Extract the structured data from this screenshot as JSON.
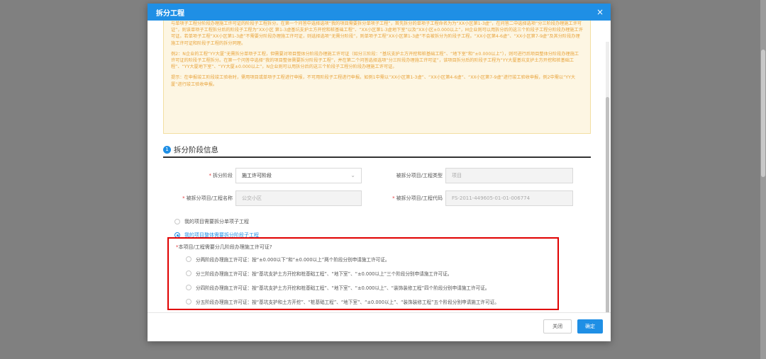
{
  "modal": {
    "title": "拆分工程",
    "close_symbol": "×"
  },
  "notice": {
    "paragraphs": [
      "与单项子工程分阶段办理施工许可证的阶段子工程拆分。在第一个问答中选择选项“我的项目需要拆分单项子工程”，首先拆分的单项子工程命名为为“XX小区第1-3虚”，在问答二中选择选项“分三阶段办理施工许可证”，则该单项子工程拆分后的阶段子工程为“XX小区 第1-3虚基坑支护土方开挖和桩基础工程”、“XX小区第1-3虚地下室”以及“XX小区±0.000以上”，M企业则可以用拆分后的这三个阶段子工程分阶段办理施工许可证。若单项子工程“XX小区第1-3虚”不需要分阶段办理施工许可证，则选择选项“无需分阶段”，则单项子工程“XX小区第1-3虚”不会被拆分为阶段子工程。“XX小区第4-6虚”、“XX小区第7-9虚”及其分阶段办理施工许可证和阶段子工程的拆分同理。",
      "例2：N企业的工程“YY大厦”无需拆分单项子工程，但需要对项目整体分阶段办理施工许可证（如分三阶段：“基坑支护土方开挖和桩基础工程”、“地下室”和“±0.000以上”），则可进行后项目整体分阶段办理施工许可证的阶段子工程拆分。在第一个问答中选择“我的项目整体需要拆分阶段子工程”，并在第二个问答选择选项“分三阶段办理施工许可证”，该项目拆分后的阶段子工程为“YY大厦基坑支护土方开挖和桩基础工程”、“YY大厦地下室”、“YY大厦±0.000以上”，N企业则可以用拆分后的这三个阶段子工程分阶段办理施工许可证。",
      "提示：在申报竣工阶段竣工验收时，需用项目或单项子工程进行申报，不可用阶段子工程进行申报。如例1中需以“XX小区第1-3虚”、“XX小区第4-6虚”、“XX小区第7-9虚”进行竣工验收申报，例2中需以“YY大厦”进行竣工验收申报。"
    ]
  },
  "section": {
    "number": "1",
    "title": "拆分阶段信息"
  },
  "form": {
    "stage_label": "拆分阶段",
    "stage_value": "施工许可阶段",
    "type_label": "被拆分项目/工程类型",
    "type_value": "项目",
    "name_label": "被拆分项目/工程名称",
    "name_value": "公交小区",
    "code_label": "被拆分项目/工程代码",
    "code_value": "FS-2011-449605-01-01-006774"
  },
  "split_options": [
    {
      "label": "我的项目需要拆分单项子工程",
      "checked": false
    },
    {
      "label": "我的项目整体需要拆分阶段子工程",
      "checked": true
    }
  ],
  "question": {
    "label": "本项目/工程需要分几阶段办理施工许可证?",
    "options": [
      "分两阶段办理施工许可证：按“±0.000以下”和“±0.000以上”两个阶段分别申请施工许可证。",
      "分三阶段办理施工许可证：按“基坑支护土方开挖和桩基础工程”、“地下室”、“±0.000以上”三个阶段分别申请施工许可证。",
      "分四阶段办理施工许可证：按“基坑支护土方开挖和桩基础工程”、“地下室”、“±0.000以上”、“装饰装修工程”四个阶段分别申请施工许可证。",
      "分五阶段办理施工许可证：按“基坑支护和土方开挖”、“桩基础工程”、“地下室”、“±0.000以上”、“装饰装修工程”五个阶段分别申请施工许可证。"
    ]
  },
  "footer": {
    "close_label": "关闭",
    "ok_label": "确定"
  }
}
